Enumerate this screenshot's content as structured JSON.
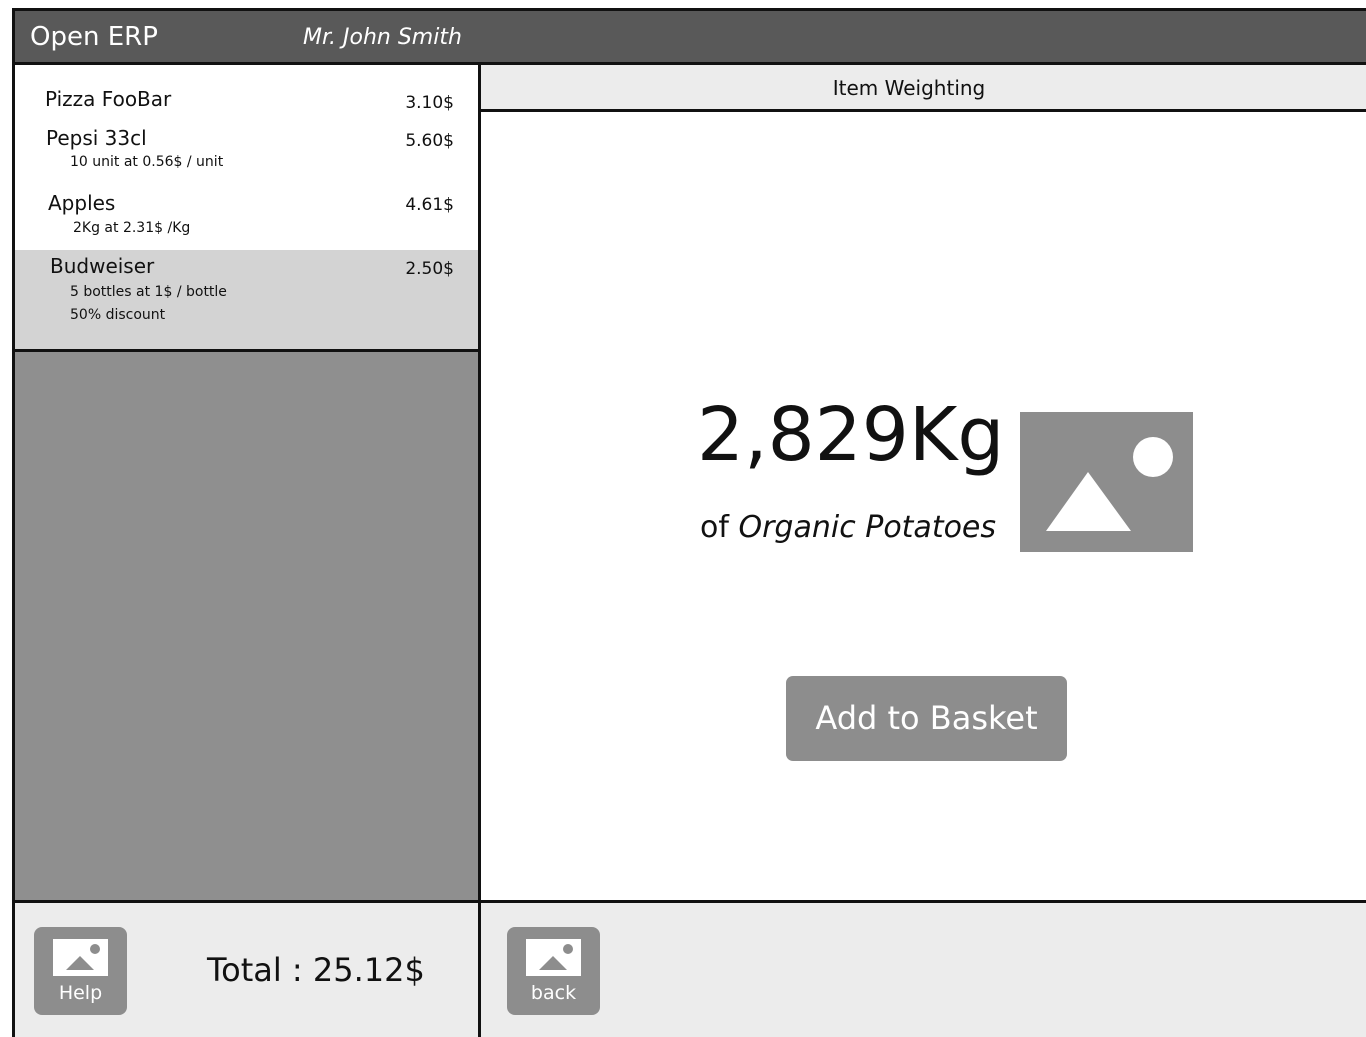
{
  "header": {
    "app_title": "Open ERP",
    "user_name": "Mr. John Smith"
  },
  "order": {
    "items": [
      {
        "name": "Pizza FooBar",
        "price": "3.10$",
        "details": []
      },
      {
        "name": "Pepsi 33cl",
        "price": "5.60$",
        "details": [
          "10 unit at 0.56$ / unit"
        ]
      },
      {
        "name": "Apples",
        "price": "4.61$",
        "details": [
          "2Kg at 2.31$ /Kg"
        ]
      },
      {
        "name": "Budweiser",
        "price": "2.50$",
        "details": [
          "5 bottles at 1$ / bottle",
          "50% discount"
        ],
        "selected": true
      }
    ],
    "total_label": "Total : 25.12$"
  },
  "footer": {
    "help_label": "Help",
    "back_label": "back"
  },
  "weighting": {
    "panel_title": "Item Weighting",
    "weight": "2,829Kg",
    "of_label": "of",
    "product_name": "Organic Potatoes",
    "add_button_label": "Add to Basket"
  },
  "icons": {
    "help": "image-placeholder-icon",
    "back": "image-placeholder-icon",
    "product": "image-placeholder-icon"
  },
  "colors": {
    "header_bg": "#595959",
    "selected_row_bg": "#d3d3d3",
    "empty_area_bg": "#8f8f8f",
    "button_bg": "#8d8d8d",
    "footer_bg": "#ececec"
  }
}
